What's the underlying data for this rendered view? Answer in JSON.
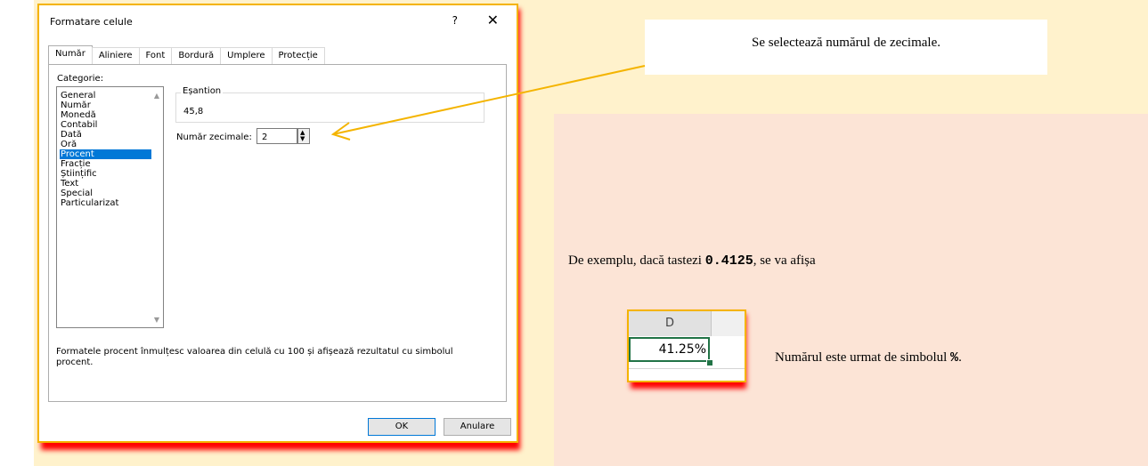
{
  "dialog": {
    "title": "Formatare celule",
    "help": "?",
    "close": "✕",
    "tabs": [
      "Număr",
      "Aliniere",
      "Font",
      "Bordură",
      "Umplere",
      "Protecție"
    ],
    "category_label": "Categorie:",
    "categories": [
      "General",
      "Număr",
      "Monedă",
      "Contabil",
      "Dată",
      "Oră",
      "Procent",
      "Fracție",
      "Științific",
      "Text",
      "Special",
      "Particularizat"
    ],
    "selected_category": "Procent",
    "sample_label": "Eșantion",
    "sample_value": "45,8",
    "decimals_label": "Număr zecimale:",
    "decimals_value": "2",
    "description": "Formatele procent înmulțesc valoarea din celulă cu 100 și afișează rezultatul cu simbolul procent.",
    "ok": "OK",
    "cancel": "Anulare"
  },
  "callout": {
    "text": "Se selectează numărul de zecimale."
  },
  "example": {
    "prefix": "De exemplu, dacă tastezi ",
    "value": "0.4125",
    "suffix": ", se va afișa"
  },
  "excel": {
    "column": "D",
    "cell_value": "41.25%"
  },
  "note": {
    "prefix": "Numărul este urmat de simbolul ",
    "symbol": "%",
    "suffix": "."
  },
  "colors": {
    "highlight": "#fff2cc",
    "pink": "#fce4d6",
    "selected": "#0078d7",
    "arrow": "#f4b400",
    "shadow": "#ff0000"
  }
}
